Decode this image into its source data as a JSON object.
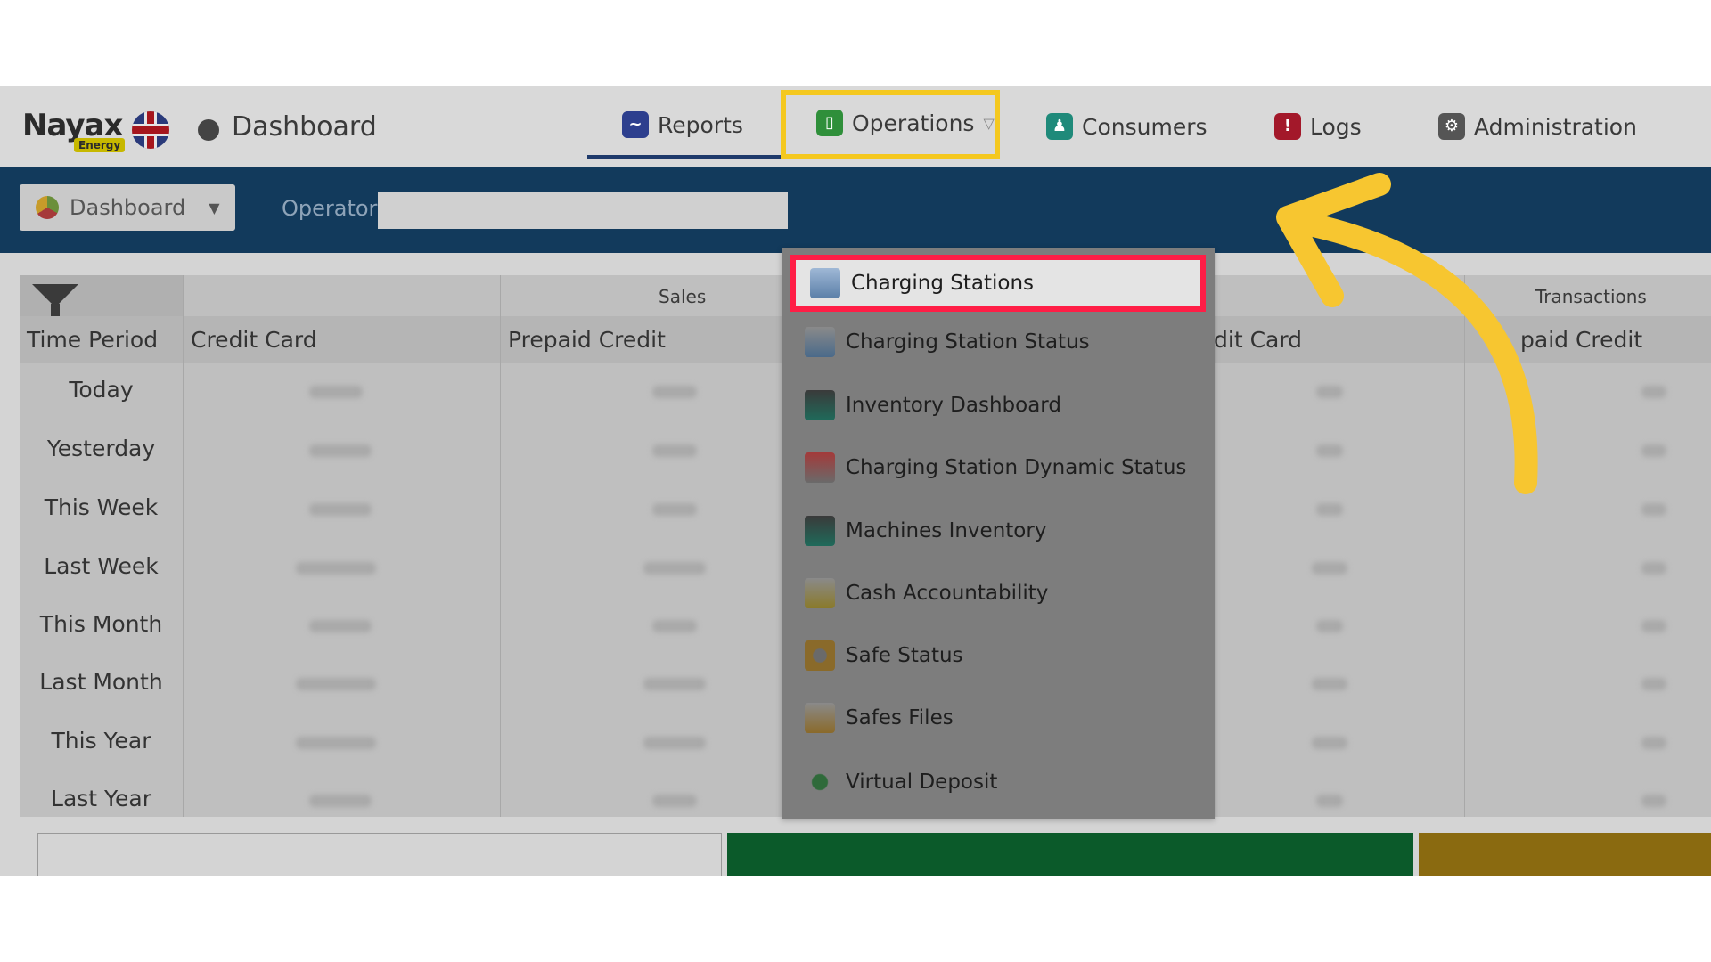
{
  "nav": {
    "logo_text": "Nayax",
    "logo_sub": "Energy",
    "dashboard_title": "Dashboard",
    "items": [
      {
        "label": "Reports",
        "icon": "reports-chart-icon"
      },
      {
        "label": "Operations",
        "icon": "operations-icon"
      },
      {
        "label": "Consumers",
        "icon": "consumers-icon"
      },
      {
        "label": "Logs",
        "icon": "logs-alert-icon"
      },
      {
        "label": "Administration",
        "icon": "administration-wrench-icon"
      }
    ]
  },
  "toolbar": {
    "dashboard_select": "Dashboard",
    "operator_label": "Operator"
  },
  "table": {
    "group_headers": [
      "Sales",
      "Transactions"
    ],
    "columns": [
      "Time Period",
      "Credit Card",
      "Prepaid Credit",
      "dit Card",
      "paid Credit"
    ],
    "rows": [
      "Today",
      "Yesterday",
      "This Week",
      "Last Week",
      "This Month",
      "Last Month",
      "This Year",
      "Last Year"
    ]
  },
  "menu": {
    "items": [
      "Charging Stations",
      "Charging Station Status",
      "Inventory Dashboard",
      "Charging Station Dynamic Status",
      "Machines Inventory",
      "Cash Accountability",
      "Safe Status",
      "Safes Files",
      "Virtual Deposit"
    ],
    "highlighted_index": 0
  },
  "colors": {
    "operations_highlight": "#f4c81f",
    "menu_highlight_border": "#ff1e46",
    "arrow": "#f7c630",
    "toolbar": "#123a5c"
  }
}
